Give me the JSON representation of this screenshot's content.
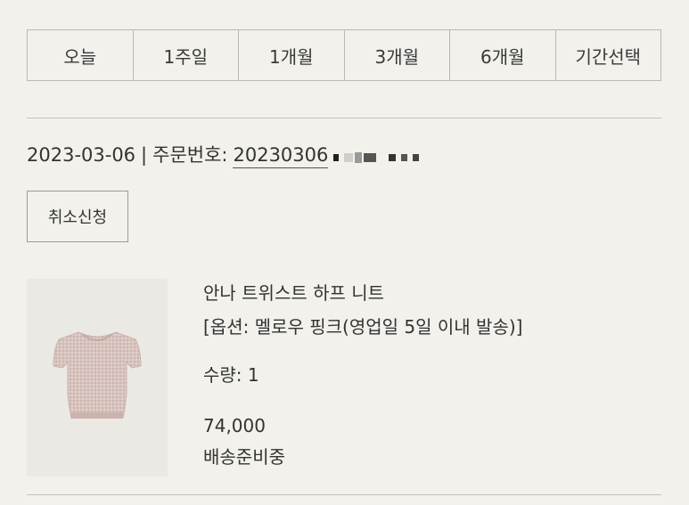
{
  "period_tabs": [
    "오늘",
    "1주일",
    "1개월",
    "3개월",
    "6개월",
    "기간선택"
  ],
  "order": {
    "date": "2023-03-06",
    "separator": "|",
    "number_label": "주문번호:",
    "number_visible": "20230306"
  },
  "cancel_button_label": "취소신청",
  "product": {
    "image_icon": "knit-top-image",
    "name": "안나 트위스트 하프 니트",
    "option": "[옵션: 멜로우 핑크(영업일 5일 이내 발송)]",
    "quantity": "수량: 1",
    "price": "74,000",
    "status": "배송준비중"
  },
  "colors": {
    "background": "#f2f1ec",
    "border": "#b9b9b5",
    "text": "#333333",
    "thumb_bg": "#ebe9e4",
    "knit_pink": "#d6c1bc"
  }
}
